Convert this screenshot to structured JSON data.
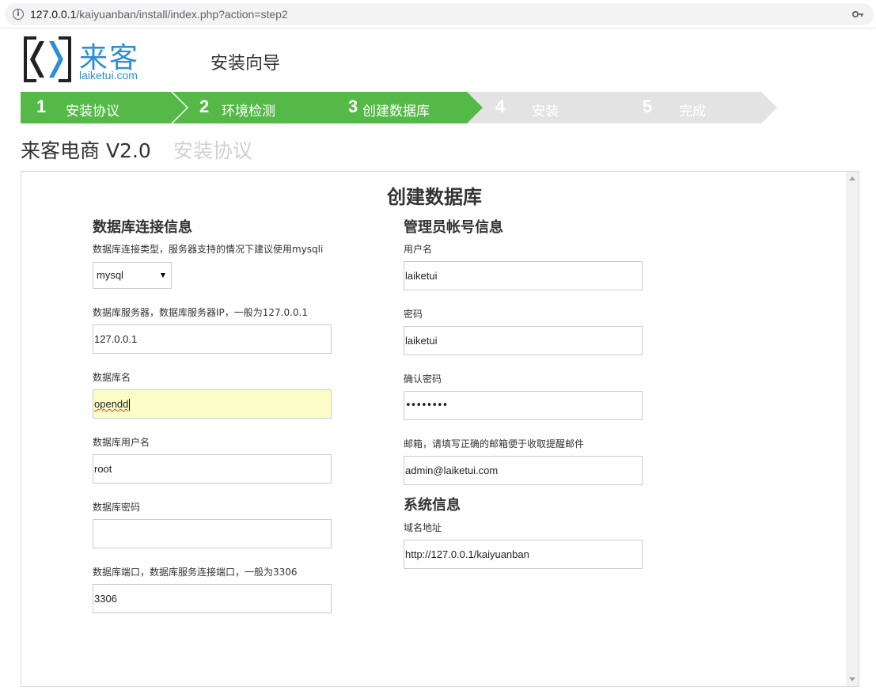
{
  "browser": {
    "url_host": "127.0.0.1",
    "url_path": "/kaiyuanban/install/index.php?action=step2"
  },
  "header": {
    "logo_cn": "来客",
    "logo_en_prefix": "laiketui",
    "logo_en_dot": ".",
    "logo_en_suffix": "com",
    "wizard_title": "安装向导"
  },
  "steps": [
    {
      "num": "1",
      "label": "安装协议",
      "status": "done"
    },
    {
      "num": "2",
      "label": "环境检测",
      "status": "done"
    },
    {
      "num": "3",
      "label": "创建数据库",
      "status": "active"
    },
    {
      "num": "4",
      "label": "安装",
      "status": "pending"
    },
    {
      "num": "5",
      "label": "完成",
      "status": "pending"
    }
  ],
  "colors": {
    "step_done": "#55b948",
    "step_pending": "#e3e3e3",
    "brand": "#2b8ed8"
  },
  "product": {
    "name": "来客电商 V2.0",
    "subtitle": "安装协议"
  },
  "main": {
    "heading": "创建数据库",
    "db_section": {
      "title": "数据库连接信息",
      "type_label": "数据库连接类型，服务器支持的情况下建议使用mysqli",
      "type_value": "mysql",
      "server_label": "数据库服务器，数据库服务器IP，一般为127.0.0.1",
      "server_value": "127.0.0.1",
      "name_label": "数据库名",
      "name_value": "opendd",
      "user_label": "数据库用户名",
      "user_value": "root",
      "password_label": "数据库密码",
      "password_value": "",
      "port_label": "数据库端口，数据库服务连接端口，一般为3306",
      "port_value": "3306"
    },
    "admin_section": {
      "title": "管理员帐号信息",
      "username_label": "用户名",
      "username_value": "laiketui",
      "password_label": "密码",
      "password_value": "laiketui",
      "confirm_label": "确认密码",
      "confirm_value": "••••••••",
      "email_label": "邮箱，请填写正确的邮箱便于收取提醒邮件",
      "email_value": "admin@laiketui.com"
    },
    "system_section": {
      "title": "系统信息",
      "domain_label": "域名地址",
      "domain_value": "http://127.0.0.1/kaiyuanban"
    }
  }
}
